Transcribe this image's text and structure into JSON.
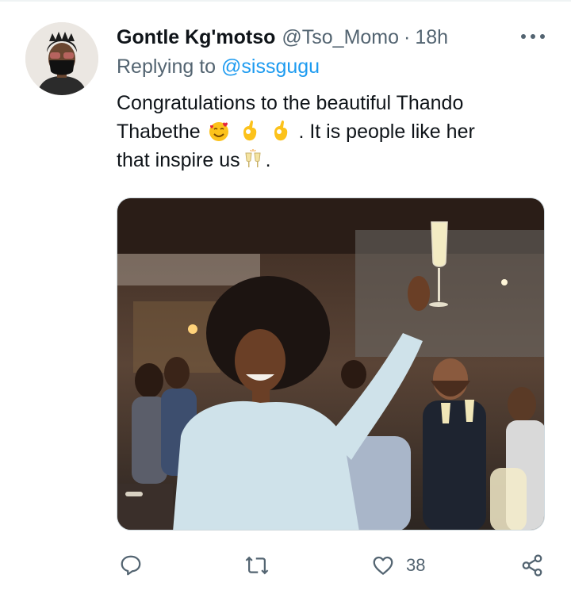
{
  "tweet": {
    "author_name": "Gontle Kg'motso",
    "author_handle": "@Tso_Momo",
    "separator": "·",
    "timestamp": "18h",
    "reply_prefix": "Replying to",
    "reply_to": "@sissgugu",
    "text_line1": "Congratulations to the beautiful Thando",
    "text_line2_start": "Thabethe",
    "text_line2_end": ". It is people like her",
    "text_line3_start": "that inspire us",
    "text_line3_end": ".",
    "emojis": [
      "smiling-face-with-hearts",
      "ok-hand",
      "ok-hand",
      "clinking-glasses"
    ],
    "media_description_icon": "celebration-photo"
  },
  "actions": {
    "reply_icon": "reply-icon",
    "retweet_icon": "retweet-icon",
    "like_icon": "heart-icon",
    "like_count": "38",
    "share_icon": "share-icon"
  },
  "colors": {
    "text": "#0f1419",
    "secondary": "#536471",
    "link": "#1d9bf0",
    "border": "#cfd9de"
  }
}
